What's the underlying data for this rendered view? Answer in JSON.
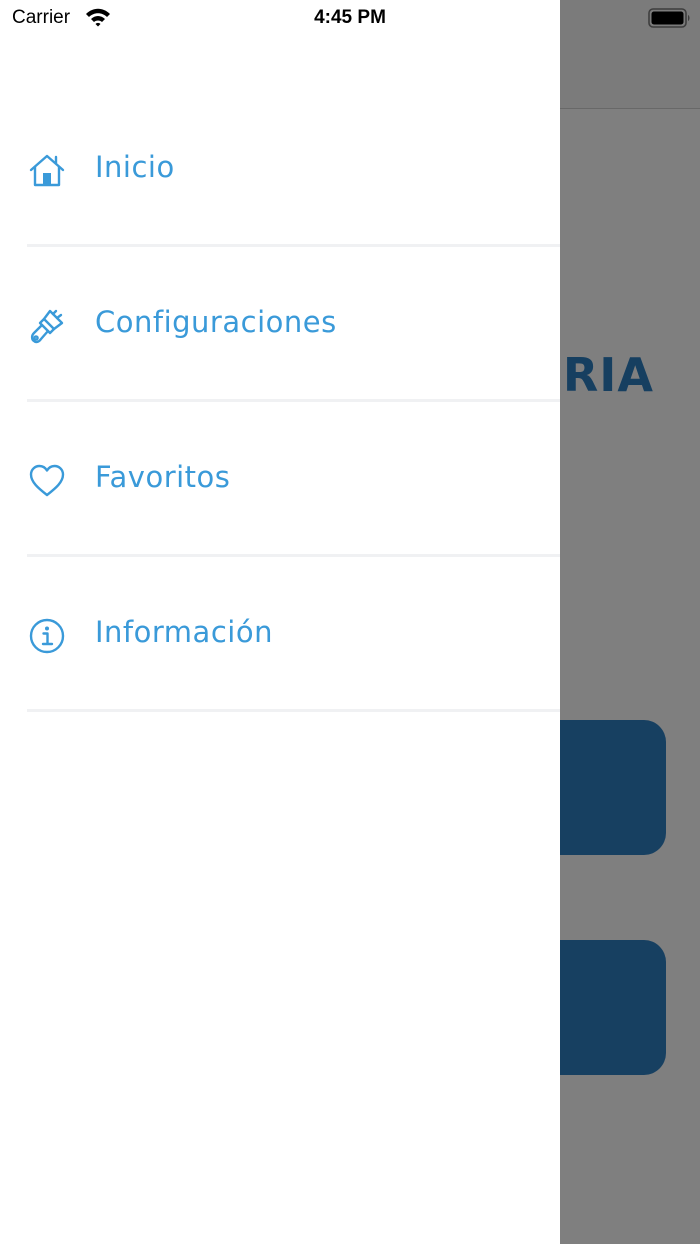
{
  "status_bar": {
    "carrier": "Carrier",
    "time": "4:45 PM"
  },
  "background": {
    "title_fragment": "ORIA",
    "accent_color": "#2f80c3"
  },
  "menu": {
    "accent_color": "#3a9ad9",
    "items": [
      {
        "label": "Inicio",
        "icon": "home-icon"
      },
      {
        "label": "Configuraciones",
        "icon": "paintbrush-icon"
      },
      {
        "label": "Favoritos",
        "icon": "heart-icon"
      },
      {
        "label": "Información",
        "icon": "info-icon"
      }
    ]
  }
}
